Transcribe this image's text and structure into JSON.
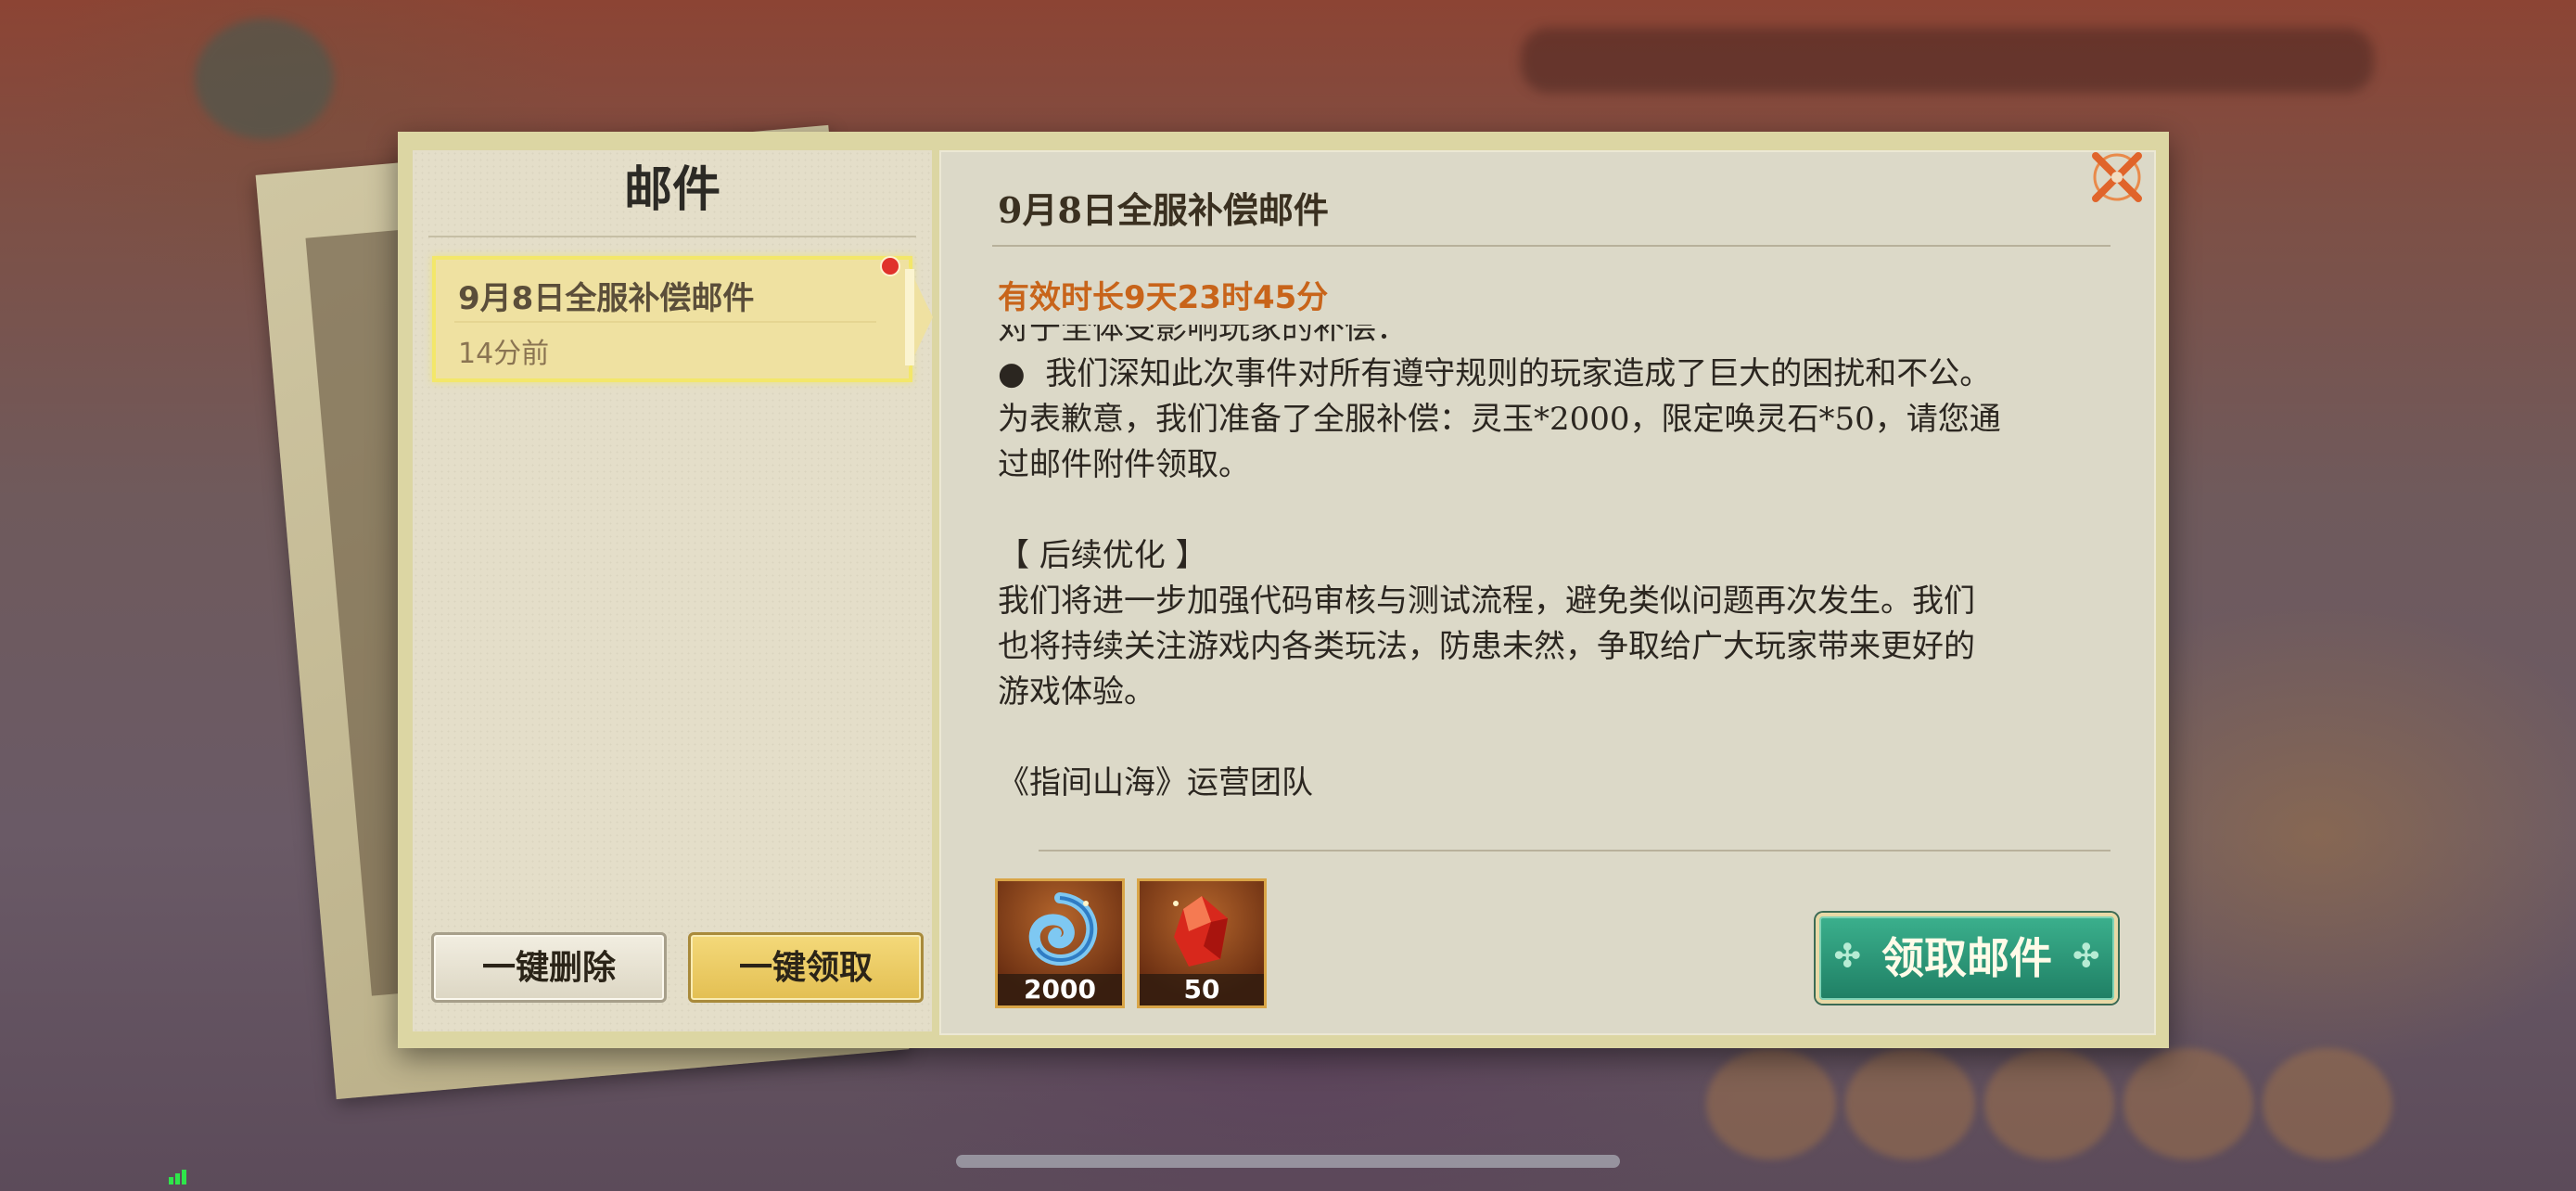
{
  "panel": {
    "title": "邮件",
    "mail_list": [
      {
        "title": "9月8日全服补偿邮件",
        "time": "14分前",
        "unread": true
      }
    ],
    "delete_all_label": "一键删除",
    "claim_all_label": "一键领取"
  },
  "mail": {
    "title": "9月8日全服补偿邮件",
    "validity": "有效时长9天23时45分",
    "body": {
      "partial_line": "对于全体受影响玩家的补偿：",
      "para1_line1": "●  我们深知此次事件对所有遵守规则的玩家造成了巨大的困扰和不公。",
      "para1_line2": "为表歉意，我们准备了全服补偿：灵玉*2000，限定唤灵石*50，请您通",
      "para1_line3": "过邮件附件领取。",
      "section_heading": "【 后续优化 】",
      "para2_line1": "我们将进一步加强代码审核与测试流程，避免类似问题再次发生。我们",
      "para2_line2": "也将持续关注游戏内各类玩法，防患未然，争取给广大玩家带来更好的",
      "para2_line3": "游戏体验。",
      "signature": "《指间山海》运营团队"
    },
    "attachments": [
      {
        "icon": "spirit-jade-icon",
        "count": "2000"
      },
      {
        "icon": "summon-stone-icon",
        "count": "50"
      }
    ],
    "claim_label": "领取邮件"
  },
  "colors": {
    "accent_orange": "#c8641a",
    "claim_green": "#1f7f64",
    "unread_red": "#e0322b",
    "selected_yellow": "#f3e76a"
  }
}
